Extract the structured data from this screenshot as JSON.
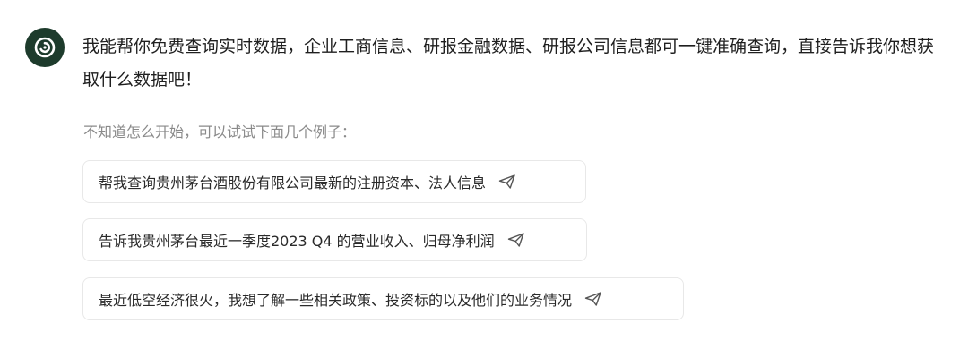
{
  "assistant": {
    "avatar_icon": "snail-shell-icon",
    "avatar_color": "#1d3b2c",
    "intro_text": "我能帮你免费查询实时数据，企业工商信息、研报金融数据、研报公司信息都可一键准确查询，直接告诉我你想获取什么数据吧！"
  },
  "suggestions": {
    "hint": "不知道怎么开始，可以试试下面几个例子：",
    "items": [
      {
        "text": "帮我查询贵州茅台酒股份有限公司最新的注册资本、法人信息",
        "icon": "send-icon"
      },
      {
        "text": "告诉我贵州茅台最近一季度2023 Q4 的营业收入、归母净利润",
        "icon": "send-icon"
      },
      {
        "text": "最近低空经济很火，我想了解一些相关政策、投资标的以及他们的业务情况",
        "icon": "send-icon"
      }
    ]
  }
}
